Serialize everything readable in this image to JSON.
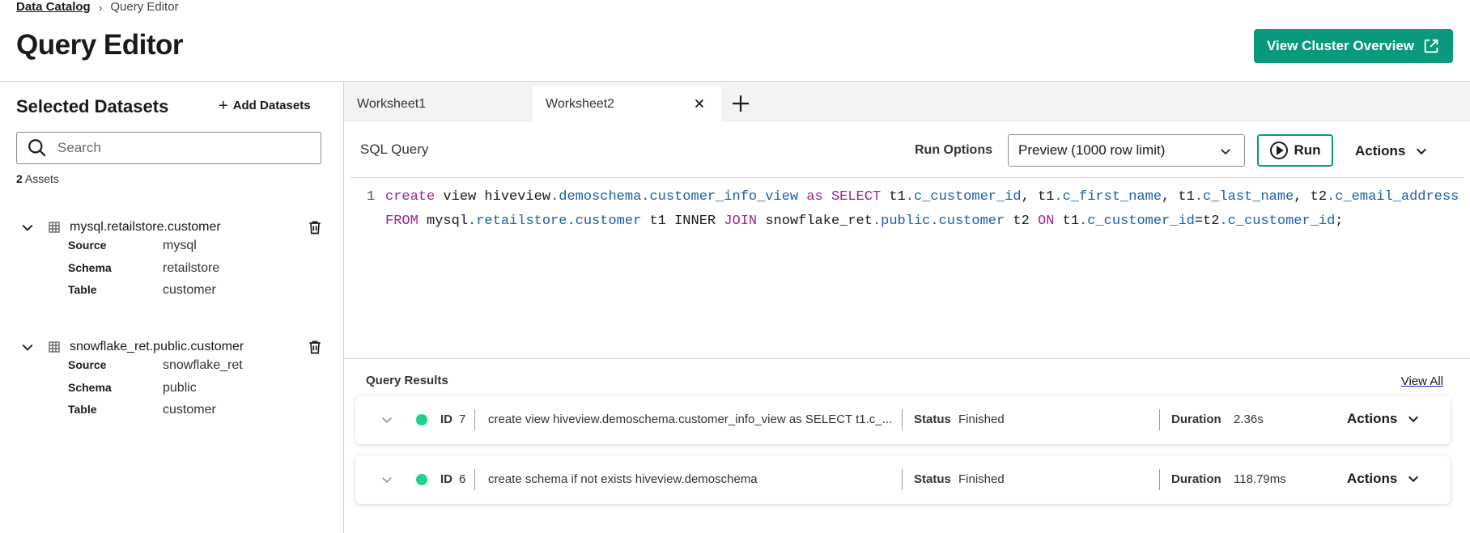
{
  "breadcrumb": {
    "parent": "Data Catalog",
    "current": "Query Editor"
  },
  "page_title": "Query Editor",
  "cluster_button": "View Cluster Overview",
  "sidebar": {
    "title": "Selected Datasets",
    "add_label": "Add Datasets",
    "search_placeholder": "Search",
    "asset_count": "2",
    "asset_label": "Assets",
    "datasets": [
      {
        "name": "mysql.retailstore.customer",
        "props": [
          {
            "label": "Source",
            "value": "mysql"
          },
          {
            "label": "Schema",
            "value": "retailstore"
          },
          {
            "label": "Table",
            "value": "customer"
          }
        ]
      },
      {
        "name": "snowflake_ret.public.customer",
        "props": [
          {
            "label": "Source",
            "value": "snowflake_ret"
          },
          {
            "label": "Schema",
            "value": "public"
          },
          {
            "label": "Table",
            "value": "customer"
          }
        ]
      }
    ]
  },
  "tabs": [
    {
      "label": "Worksheet1",
      "active": false
    },
    {
      "label": "Worksheet2",
      "active": true
    }
  ],
  "sql": {
    "label": "SQL Query",
    "run_options_label": "Run Options",
    "run_option_selected": "Preview (1000 row limit)",
    "run_label": "Run",
    "actions_label": "Actions",
    "line_number": "1",
    "code": "create view hiveview.demoschema.customer_info_view as SELECT t1.c_customer_id, t1.c_first_name, t1.c_last_name, t2.c_email_address FROM mysql.retailstore.customer t1 INNER JOIN snowflake_ret.public.customer t2 ON t1.c_customer_id=t2.c_customer_id;"
  },
  "results": {
    "title": "Query Results",
    "view_all": "View All",
    "rows": [
      {
        "id_label": "ID",
        "id": "7",
        "query": "create view hiveview.demoschema.customer_info_view as SELECT t1.c_...",
        "status_label": "Status",
        "status": "Finished",
        "duration_label": "Duration",
        "duration": "2.36s",
        "actions": "Actions"
      },
      {
        "id_label": "ID",
        "id": "6",
        "query": "create schema if not exists hiveview.demoschema",
        "status_label": "Status",
        "status": "Finished",
        "duration_label": "Duration",
        "duration": "118.79ms",
        "actions": "Actions"
      }
    ]
  },
  "colors": {
    "accent": "#0a9a7b",
    "status_ok": "#1fd18a",
    "keyword": "#a0228c",
    "identifier": "#1e5fa8"
  }
}
